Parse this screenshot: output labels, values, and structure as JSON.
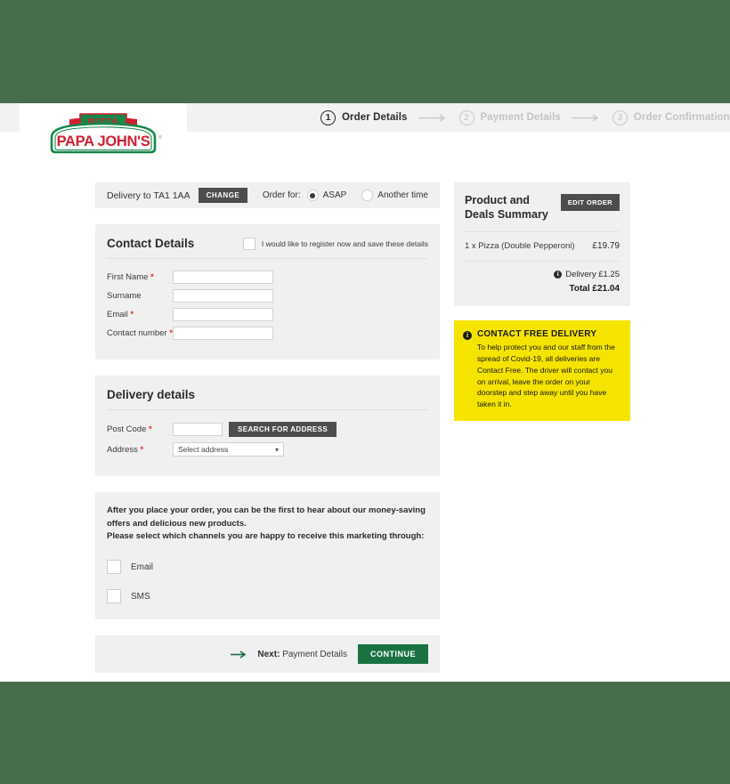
{
  "brand": {
    "logo_banner_text": "PIZZA",
    "logo_name": "PAPA JOHN'S",
    "green": "#17864a",
    "red": "#d0202f",
    "page_backdrop": "#476d4c"
  },
  "steps": [
    {
      "number": "1",
      "label": "Order Details",
      "state": "active"
    },
    {
      "number": "2",
      "label": "Payment Details",
      "state": "inactive"
    },
    {
      "number": "3",
      "label": "Order Confirmation",
      "state": "inactive"
    }
  ],
  "delivery_strip": {
    "delivery_to": "Delivery to TA1 1AA",
    "change_label": "CHANGE",
    "order_for_label": "Order for:",
    "options": [
      {
        "label": "ASAP",
        "selected": true
      },
      {
        "label": "Another time",
        "selected": false
      }
    ]
  },
  "contact_details": {
    "title": "Contact Details",
    "register_label": "I would like to register now and save these details",
    "register_checked": false,
    "fields": [
      {
        "label": "First Name",
        "required": true,
        "value": "",
        "placeholder": ""
      },
      {
        "label": "Surname",
        "required": false,
        "value": "",
        "placeholder": ""
      },
      {
        "label": "Email",
        "required": true,
        "value": "",
        "placeholder": ""
      },
      {
        "label": "Contact number",
        "required": true,
        "value": "",
        "placeholder": ""
      }
    ]
  },
  "delivery_details": {
    "title": "Delivery details",
    "postcode_label": "Post Code",
    "postcode_value": "",
    "search_label": "SEARCH FOR ADDRESS",
    "address_label": "Address",
    "address_selected": "Select address"
  },
  "marketing": {
    "line1": "After you place your order, you can be the first to hear about our money-saving offers and delicious new products.",
    "line2": "Please select which channels you are happy to receive this marketing through:",
    "channels": [
      {
        "label": "Email",
        "checked": false
      },
      {
        "label": "SMS",
        "checked": false
      }
    ]
  },
  "footer": {
    "next_prefix": "Next:",
    "next_step": "Payment Details",
    "continue_label": "CONTINUE"
  },
  "summary": {
    "title": "Product and Deals Summary",
    "edit_label": "EDIT ORDER",
    "items": [
      {
        "name": "1 x Pizza (Double Pepperoni)",
        "price": "£19.79"
      }
    ],
    "delivery_text": "Delivery £1.25",
    "total_text": "Total £21.04"
  },
  "notice": {
    "title": "CONTACT FREE DELIVERY",
    "body": "To help protect you and our staff from the spread of Covid-19, all deliveries are Contact Free. The driver will contact you on arrival, leave the order on your doorstep and step away until you have taken it in."
  }
}
